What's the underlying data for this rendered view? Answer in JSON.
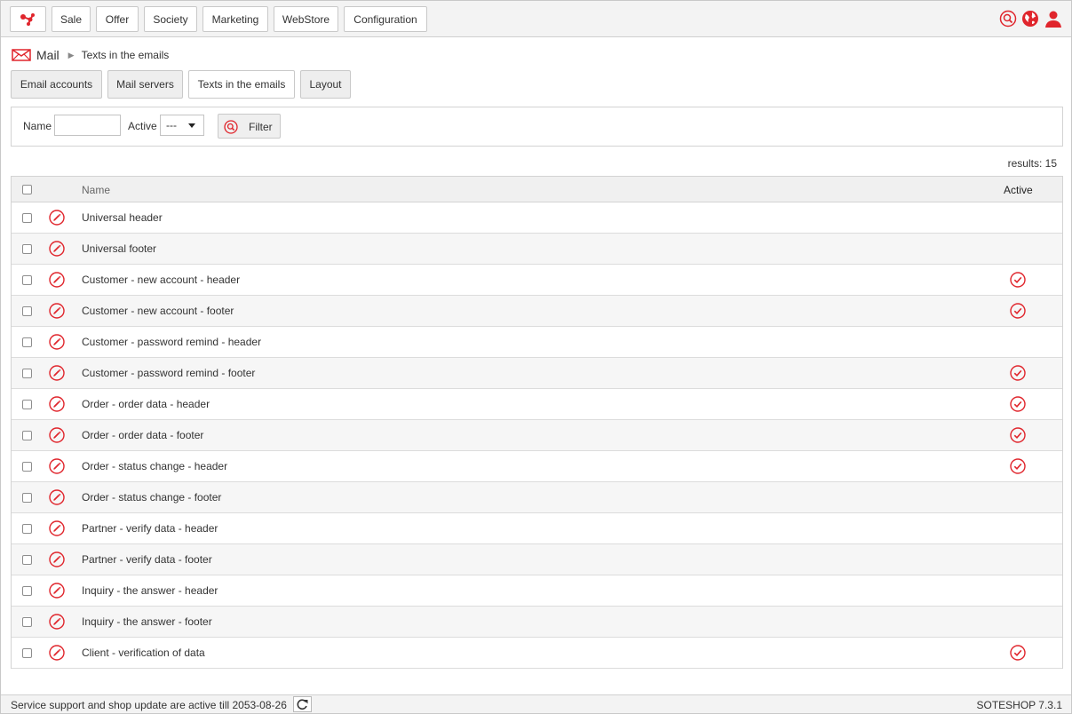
{
  "nav": {
    "menu": [
      "Sale",
      "Offer",
      "Society",
      "Marketing",
      "WebStore",
      "Configuration"
    ],
    "icons": [
      "search-icon",
      "globe-icon",
      "user-icon"
    ],
    "accent": "#e0252c"
  },
  "breadcrumb": {
    "section": "Mail",
    "current": "Texts in the emails"
  },
  "tabs": [
    "Email accounts",
    "Mail servers",
    "Texts in the emails",
    "Layout"
  ],
  "active_tab": "Texts in the emails",
  "filter": {
    "name_label": "Name",
    "name_value": "",
    "active_label": "Active",
    "active_value": "---",
    "button_label": "Filter"
  },
  "results_label": "results: 15",
  "table": {
    "headers": {
      "name": "Name",
      "active": "Active"
    },
    "rows": [
      {
        "name": "Universal header",
        "active": false
      },
      {
        "name": "Universal footer",
        "active": false
      },
      {
        "name": "Customer - new account - header",
        "active": true
      },
      {
        "name": "Customer - new account - footer",
        "active": true
      },
      {
        "name": "Customer - password remind - header",
        "active": false
      },
      {
        "name": "Customer - password remind - footer",
        "active": true
      },
      {
        "name": "Order - order data - header",
        "active": true
      },
      {
        "name": "Order - order data - footer",
        "active": true
      },
      {
        "name": "Order - status change - header",
        "active": true
      },
      {
        "name": "Order - status change - footer",
        "active": false
      },
      {
        "name": "Partner - verify data - header",
        "active": false
      },
      {
        "name": "Partner - verify data - footer",
        "active": false
      },
      {
        "name": "Inquiry - the answer - header",
        "active": false
      },
      {
        "name": "Inquiry - the answer - footer",
        "active": false
      },
      {
        "name": "Client - verification of data",
        "active": true
      }
    ]
  },
  "footer": {
    "support": "Service support and shop update are active till 2053-08-26",
    "version": "SOTESHOP 7.3.1"
  }
}
